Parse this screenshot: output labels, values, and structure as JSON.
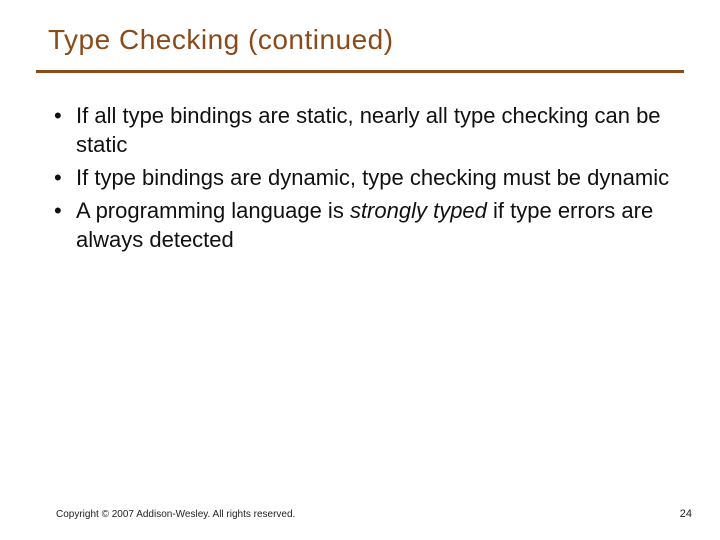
{
  "title": "Type Checking (continued)",
  "bullets": [
    {
      "pre": "If all type bindings are static, nearly all type checking can be static",
      "em": "",
      "post": ""
    },
    {
      "pre": "If type bindings are dynamic, type checking must be dynamic",
      "em": "",
      "post": ""
    },
    {
      "pre": "A programming language is ",
      "em": "strongly typed",
      "post": " if type errors are always detected"
    }
  ],
  "footer": {
    "copyright": "Copyright © 2007 Addison-Wesley. All rights reserved.",
    "page": "24"
  }
}
